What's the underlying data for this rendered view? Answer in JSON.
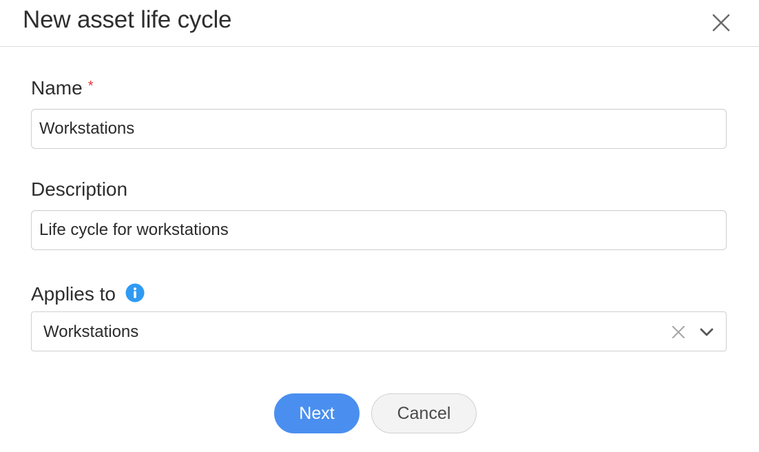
{
  "dialog": {
    "title": "New asset life cycle",
    "close_icon": "close-icon"
  },
  "fields": {
    "name": {
      "label": "Name",
      "required_marker": "*",
      "value": "Workstations"
    },
    "description": {
      "label": "Description",
      "value": "Life cycle for workstations"
    },
    "applies_to": {
      "label": "Applies to",
      "info_icon": "info-icon",
      "selected": "Workstations",
      "clear_icon": "clear-icon",
      "dropdown_icon": "chevron-down-icon"
    }
  },
  "actions": {
    "next_label": "Next",
    "cancel_label": "Cancel"
  },
  "colors": {
    "primary": "#4a8ff0",
    "required": "#e0353a",
    "info": "#2f9af3"
  }
}
